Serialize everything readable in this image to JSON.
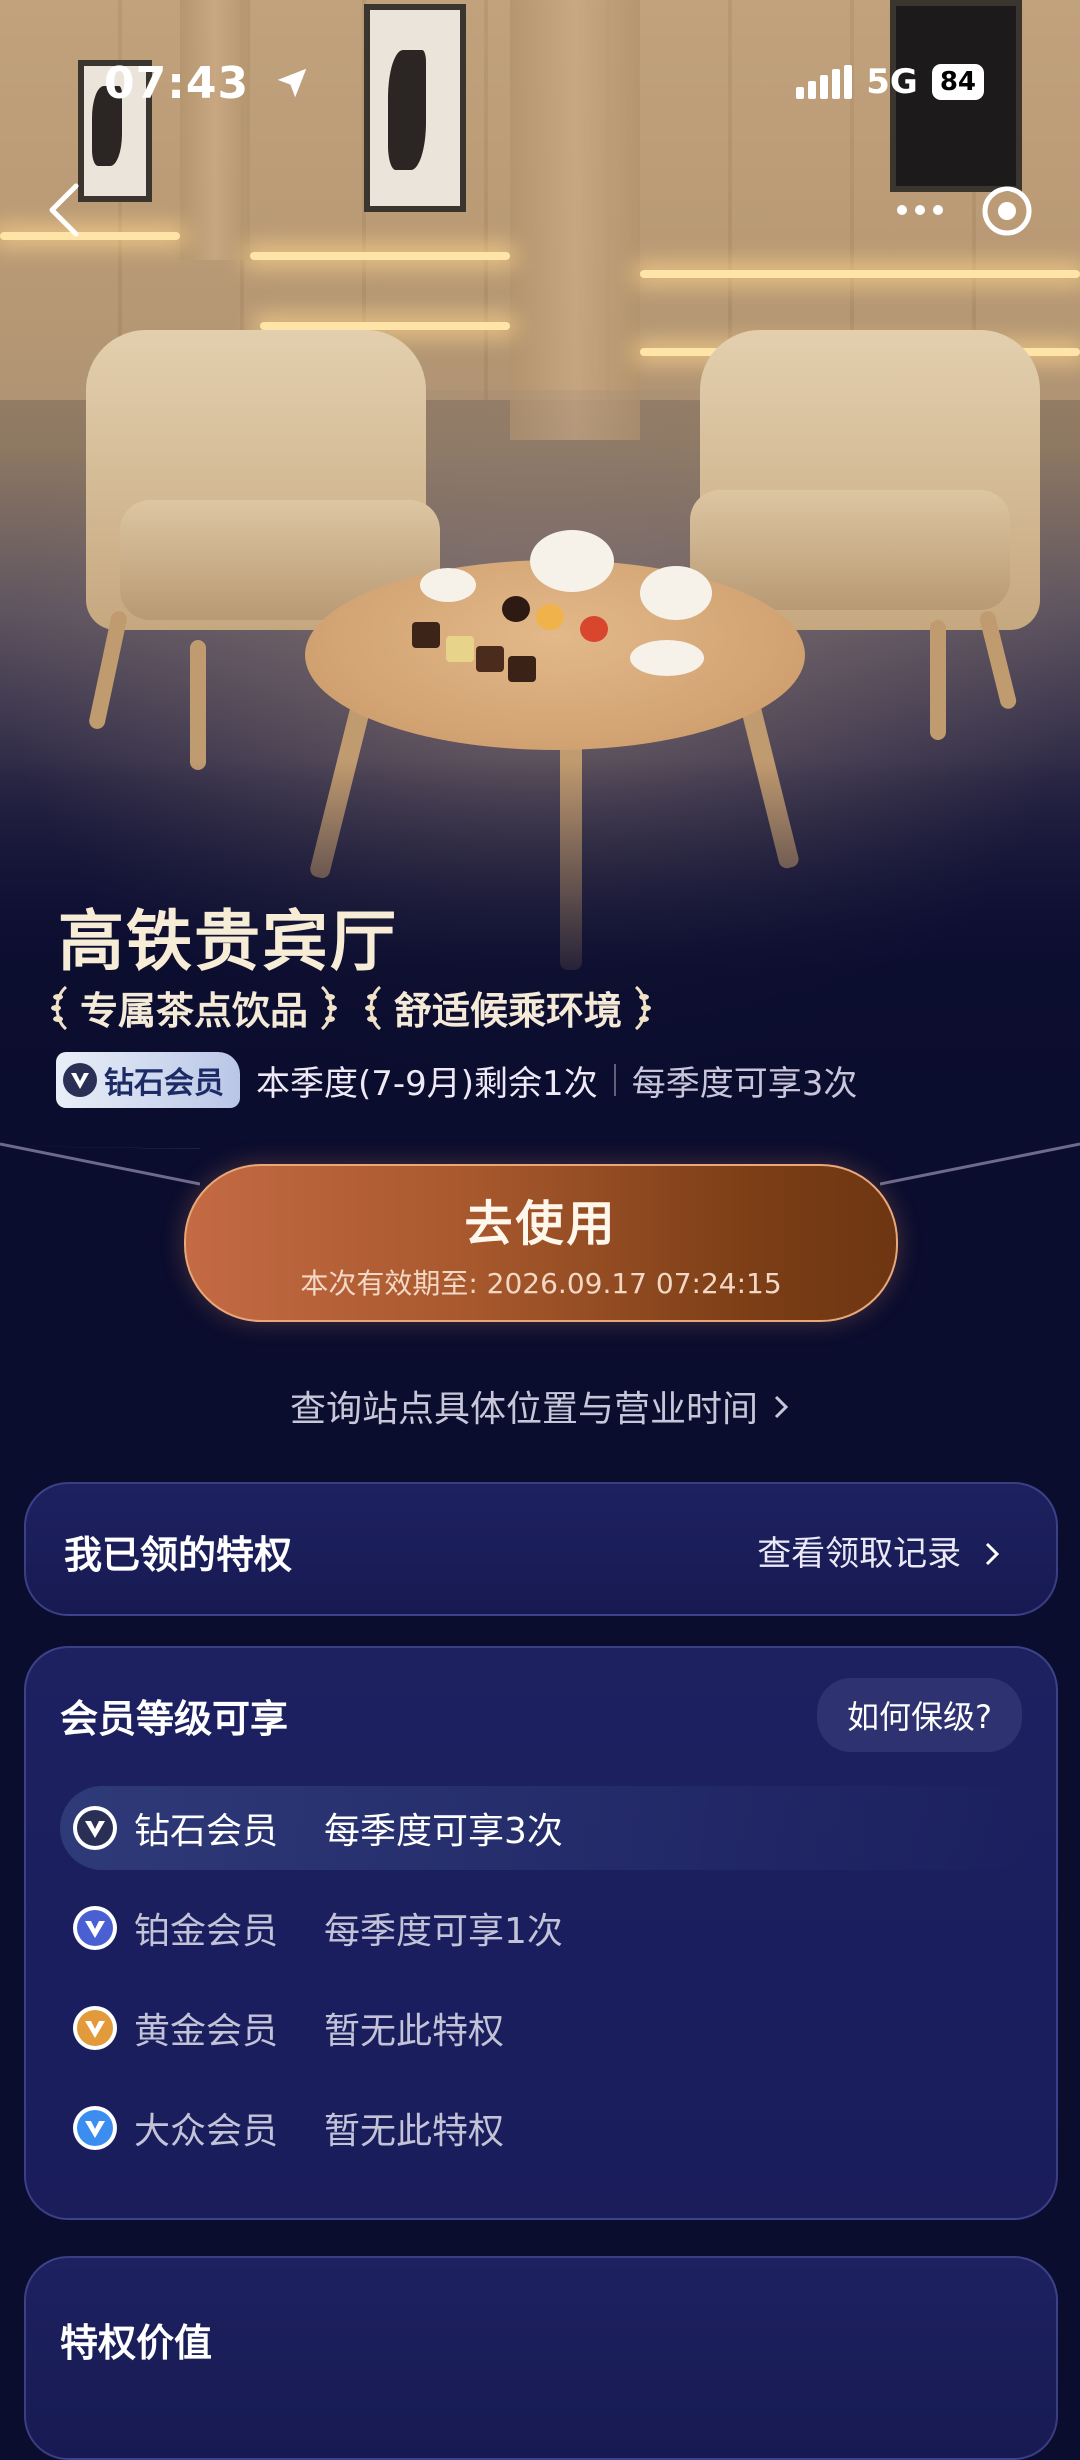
{
  "status_bar": {
    "time": "07:43",
    "network": "5G",
    "battery": "84"
  },
  "hero": {
    "title": "高铁贵宾厅",
    "tags": [
      "专属茶点饮品",
      "舒适候乘环境"
    ],
    "member_badge": "钻石会员",
    "remaining_text": "本季度(7-9月)剩余1次",
    "quota_text": "每季度可享3次"
  },
  "use_button": {
    "label": "去使用",
    "validity": "本次有效期至: 2026.09.17 07:24:15"
  },
  "query_link": "查询站点具体位置与营业时间",
  "claimed": {
    "title": "我已领的特权",
    "link": "查看领取记录"
  },
  "levels": {
    "title": "会员等级可享",
    "how_button": "如何保级?",
    "tiers": [
      {
        "name": "钻石会员",
        "desc": "每季度可享3次",
        "color": "#2a2f55"
      },
      {
        "name": "铂金会员",
        "desc": "每季度可享1次",
        "color": "#4a5fd1"
      },
      {
        "name": "黄金会员",
        "desc": "暂无此特权",
        "color": "#e29a3a"
      },
      {
        "name": "大众会员",
        "desc": "暂无此特权",
        "color": "#3b8ef0"
      }
    ]
  },
  "value_section": {
    "title": "特权价值"
  }
}
